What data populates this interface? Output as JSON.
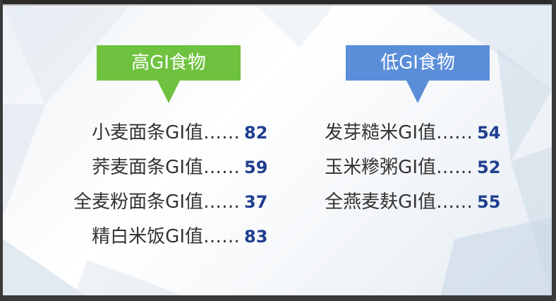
{
  "high_gi": {
    "title": "高GI食物",
    "color": "#6fc23f",
    "items": [
      {
        "label": "小麦面条GI值……",
        "value": "82"
      },
      {
        "label": "荞麦面条GI值……",
        "value": "59"
      },
      {
        "label": "全麦粉面条GI值……",
        "value": "37"
      },
      {
        "label": "精白米饭GI值……",
        "value": "83"
      }
    ]
  },
  "low_gi": {
    "title": "低GI食物",
    "color": "#5b8ed8",
    "items": [
      {
        "label": "发芽糙米GI值……",
        "value": "54"
      },
      {
        "label": "玉米糁粥GI值……",
        "value": "52"
      },
      {
        "label": "全燕麦麸GI值……",
        "value": "55"
      }
    ]
  },
  "value_color": "#1f3f8f"
}
